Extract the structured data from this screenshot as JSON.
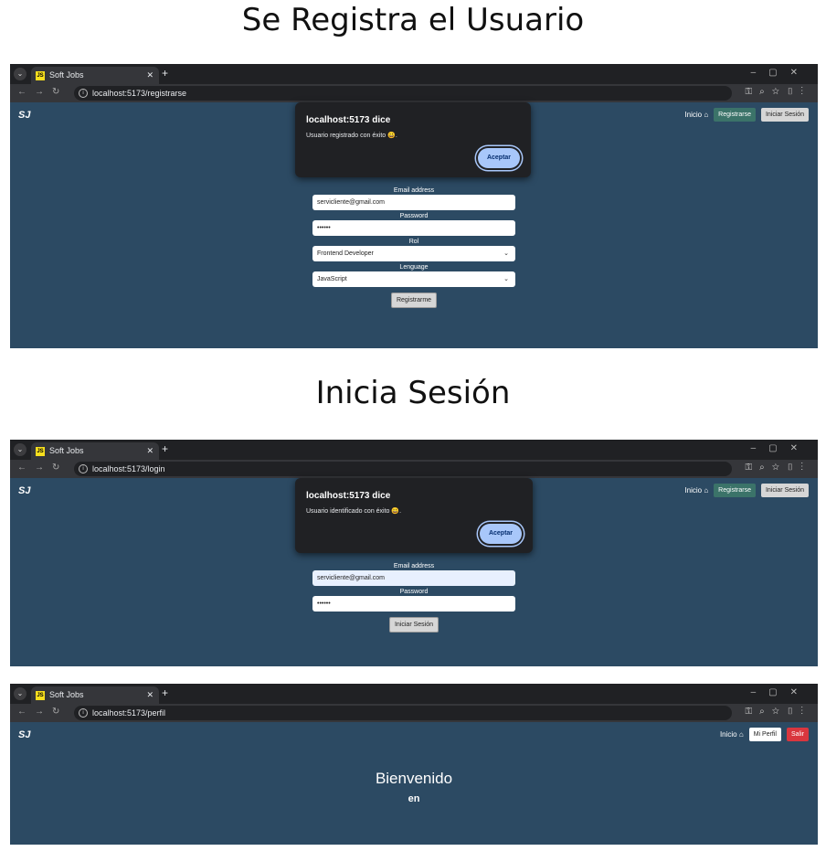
{
  "headings": {
    "register": "Se Registra el Usuario",
    "login": "Inicia Sesión"
  },
  "browser": {
    "tab_title": "Soft Jobs",
    "favicon": "JS"
  },
  "urls": {
    "register": "localhost:5173/registrarse",
    "login": "localhost:5173/login",
    "profile": "localhost:5173/perfil"
  },
  "app": {
    "brand": "SJ",
    "nav_inicio": "Inicio",
    "btn_registrarse": "Registrarse",
    "btn_iniciar_sesion": "Iniciar Sesión",
    "btn_mi_perfil": "Mi Perfil",
    "btn_salir": "Salir"
  },
  "dialog": {
    "title": "localhost:5173 dice",
    "register_msg": "Usuario registrado con éxito 😀.",
    "login_msg": "Usuario identificado con éxito 😀.",
    "accept": "Aceptar"
  },
  "register_form": {
    "email_label": "Email address",
    "email_value": "servicliente@gmail.com",
    "password_label": "Password",
    "password_value": "••••••",
    "rol_label": "Rol",
    "rol_value": "Frontend Developer",
    "lenguage_label": "Lenguage",
    "lenguage_value": "JavaScript",
    "submit": "Registrarme"
  },
  "login_form": {
    "email_label": "Email address",
    "email_value": "servicliente@gmail.com",
    "password_label": "Password",
    "password_value": "••••••",
    "submit": "Iniciar Sesión"
  },
  "profile": {
    "welcome": "Bienvenido",
    "subtitle": "en"
  }
}
